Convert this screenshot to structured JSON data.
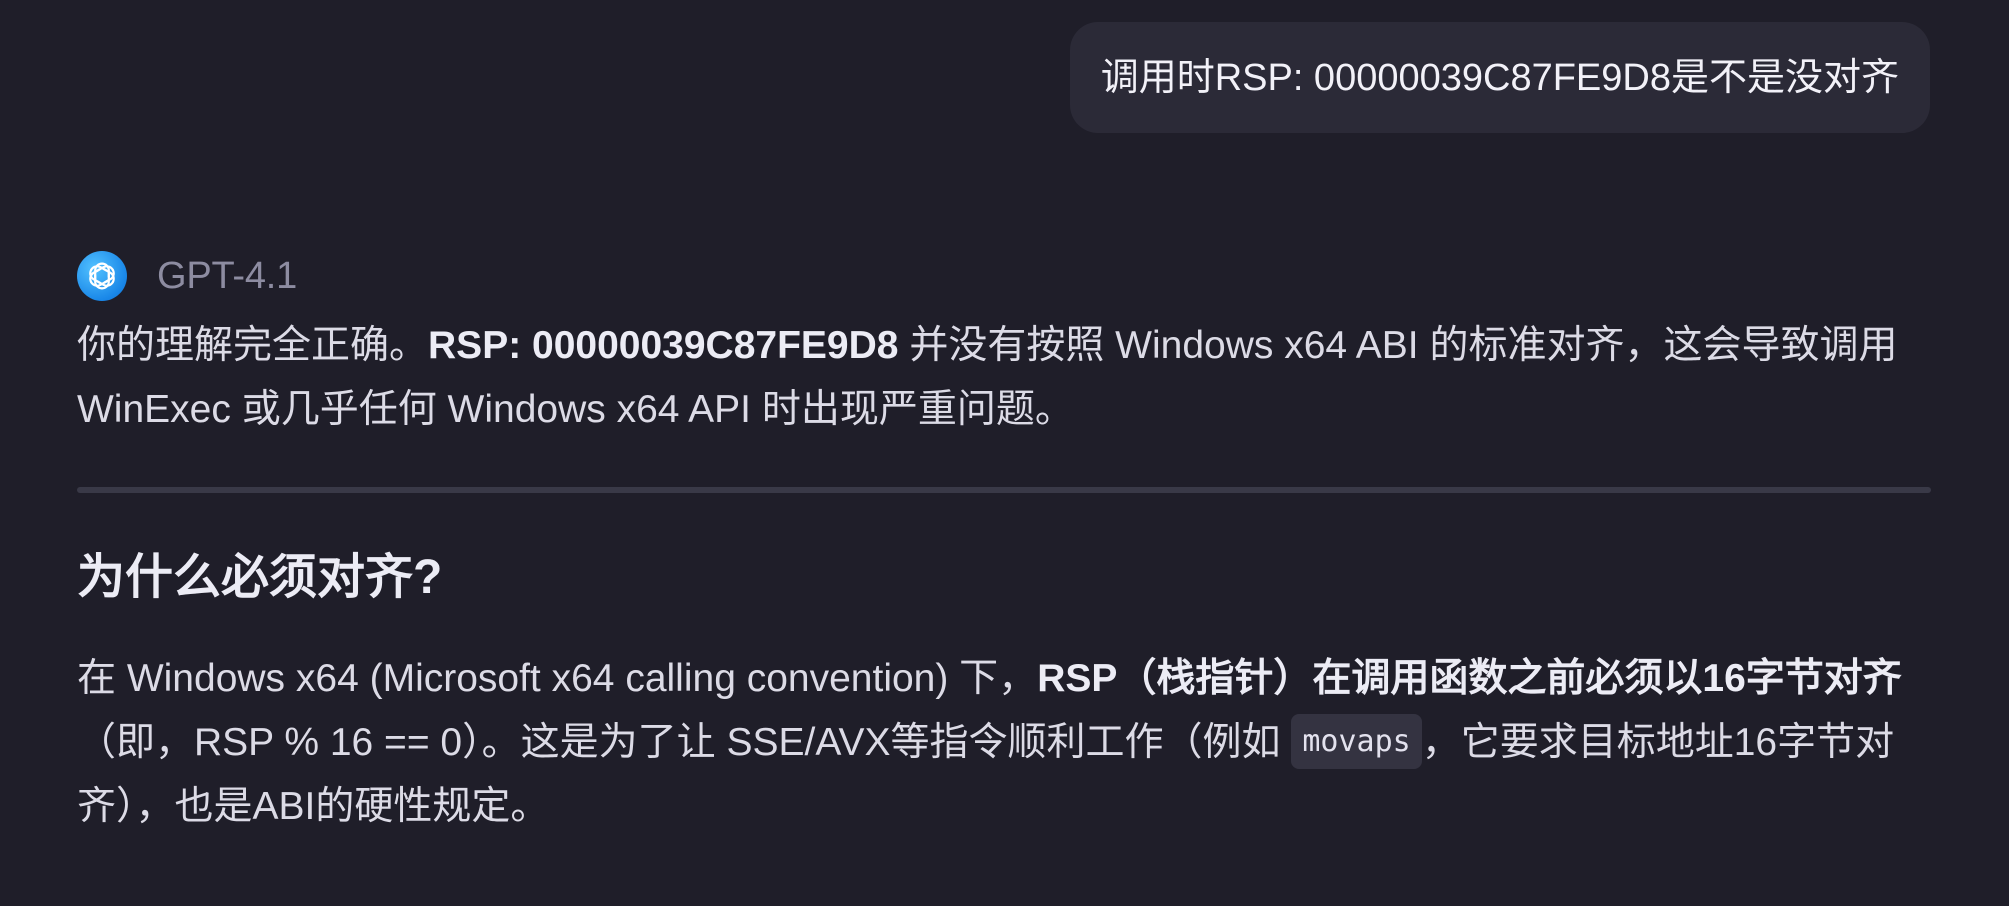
{
  "user_message": {
    "text": "调用时RSP: 00000039C87FE9D8是不是没对齐"
  },
  "assistant": {
    "model_name": "GPT-4.1",
    "logo_icon": "openai-logo-icon",
    "intro": {
      "lead": "你的理解完全正确。",
      "bold": "RSP: 00000039C87FE9D8",
      "tail": " 并没有按照 Windows x64 ABI 的标准对齐，这会导致调用 WinExec 或几乎任何 Windows x64 API 时出现严重问题。"
    },
    "section": {
      "title": "为什么必须对齐?",
      "text_prefix": "在 Windows x64 (Microsoft x64 calling convention) 下，",
      "bold": "RSP（栈指针）在调用函数之前必须以16字节对齐",
      "text_middle": "（即，RSP % 16 == 0）。这是为了让 SSE/AVX等指令顺利工作（例如 ",
      "code": "movaps",
      "text_suffix": "，它要求目标地址16字节对齐），也是ABI的硬性规定。"
    }
  },
  "theme": {
    "background": "#1f1e29",
    "bubble_background": "#2b2a37",
    "text": "#dcdbe6",
    "muted_text": "#8d8ca1",
    "divider": "#393947",
    "logo_blue": "#1987e8"
  }
}
